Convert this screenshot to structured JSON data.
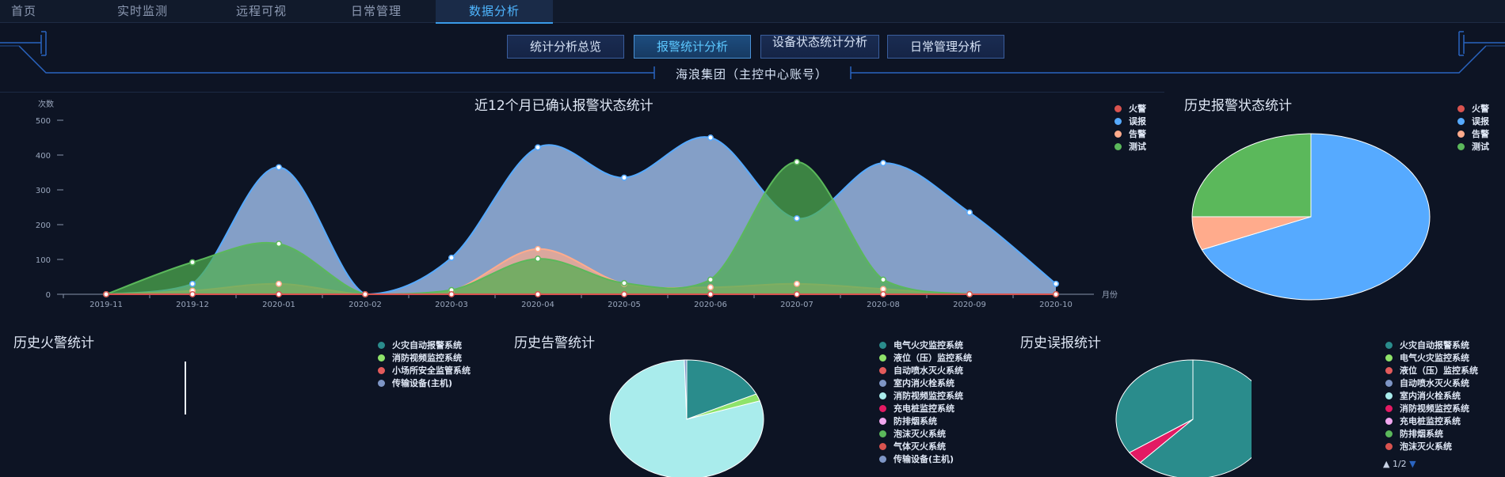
{
  "nav": {
    "tabs": [
      "首页",
      "实时监测",
      "远程可视",
      "日常管理",
      "数据分析"
    ],
    "active_index": 4
  },
  "subnav": {
    "tabs": [
      "统计分析总览",
      "报警统计分析",
      "设备状态统计分析",
      "日常管理分析"
    ],
    "active_index": 1
  },
  "company": "海浪集团（主控中心账号）",
  "colors": {
    "fire": "#d9534f",
    "false_alarm": "#56aaff",
    "warning": "#ffab8c",
    "test": "#5bb85b",
    "accent": "#4fb6ff"
  },
  "main_chart": {
    "title": "近12个月已确认报警状态统计",
    "ylabel": "次数",
    "xlabel": "月份",
    "legend": [
      "火警",
      "误报",
      "告警",
      "测试"
    ],
    "chart_data": {
      "type": "area",
      "title": "近12个月已确认报警状态统计",
      "ylabel": "次数",
      "xlabel": "月份",
      "ylim": [
        0,
        500
      ],
      "yticks": [
        0,
        100,
        200,
        300,
        400,
        500
      ],
      "categories": [
        "2019-11",
        "2019-12",
        "2020-01",
        "2020-02",
        "2020-03",
        "2020-04",
        "2020-05",
        "2020-06",
        "2020-07",
        "2020-08",
        "2020-09",
        "2020-10"
      ],
      "series": [
        {
          "name": "火警",
          "values": [
            0,
            0,
            0,
            0,
            0,
            0,
            0,
            0,
            0,
            0,
            0,
            0
          ]
        },
        {
          "name": "误报",
          "values": [
            0,
            30,
            365,
            0,
            105,
            422,
            335,
            450,
            218,
            377,
            235,
            30
          ]
        },
        {
          "name": "告警",
          "values": [
            0,
            10,
            30,
            0,
            10,
            130,
            30,
            20,
            30,
            15,
            0,
            0
          ]
        },
        {
          "name": "测试",
          "values": [
            0,
            92,
            145,
            0,
            12,
            102,
            32,
            42,
            380,
            42,
            0,
            0
          ]
        }
      ],
      "grid": false,
      "legend_position": "top-right"
    }
  },
  "history_status": {
    "title": "历史报警状态统计",
    "legend": [
      "火警",
      "误报",
      "告警",
      "测试"
    ],
    "chart_data": {
      "type": "pie",
      "title": "历史报警状态统计",
      "labels": [
        "火警",
        "误报",
        "告警",
        "测试"
      ],
      "values": [
        0,
        68.5,
        6.5,
        25
      ]
    }
  },
  "fire_history": {
    "title": "历史火警统计",
    "legend": [
      "火灾自动报警系统",
      "消防视频监控系统",
      "小场所安全监管系统",
      "传输设备(主机)"
    ],
    "legend_colors": [
      "#2a8c8c",
      "#8fe36a",
      "#e35b5b",
      "#7e96c6"
    ]
  },
  "warning_history": {
    "title": "历史告警统计",
    "legend": [
      "电气火灾监控系统",
      "液位（压）监控系统",
      "自动喷水灭火系统",
      "室内消火栓系统",
      "消防视频监控系统",
      "充电桩监控系统",
      "防排烟系统",
      "泡沫灭火系统",
      "气体灭火系统",
      "传输设备(主机)"
    ],
    "legend_colors": [
      "#2a8c8c",
      "#8fe36a",
      "#e35b5b",
      "#7e96c6",
      "#a9ecec",
      "#e31a63",
      "#f1a7ef",
      "#5bb85b",
      "#d9534f",
      "#7e96c6"
    ],
    "chart_data": {
      "type": "pie",
      "title": "历史告警统计",
      "labels": [
        "电气火灾监控系统",
        "液位（压）监控系统",
        "消防视频监控系统",
        "传输设备(主机)"
      ],
      "values": [
        18,
        2,
        79.5,
        0.5
      ]
    }
  },
  "false_history": {
    "title": "历史误报统计",
    "legend": [
      "火灾自动报警系统",
      "电气火灾监控系统",
      "液位（压）监控系统",
      "自动喷水灭火系统",
      "室内消火栓系统",
      "消防视频监控系统",
      "充电桩监控系统",
      "防排烟系统",
      "泡沫灭火系统"
    ],
    "legend_colors": [
      "#2a8c8c",
      "#8fe36a",
      "#e35b5b",
      "#7e96c6",
      "#a9ecec",
      "#e31a63",
      "#f1a7ef",
      "#5bb85b",
      "#d9534f"
    ],
    "pager": "1/2",
    "chart_data": {
      "type": "pie",
      "title": "历史误报统计",
      "labels": [
        "火灾自动报警系统",
        "消防视频监控系统",
        "充电桩监控系统"
      ],
      "values": [
        96,
        3.5,
        0.5
      ]
    }
  }
}
